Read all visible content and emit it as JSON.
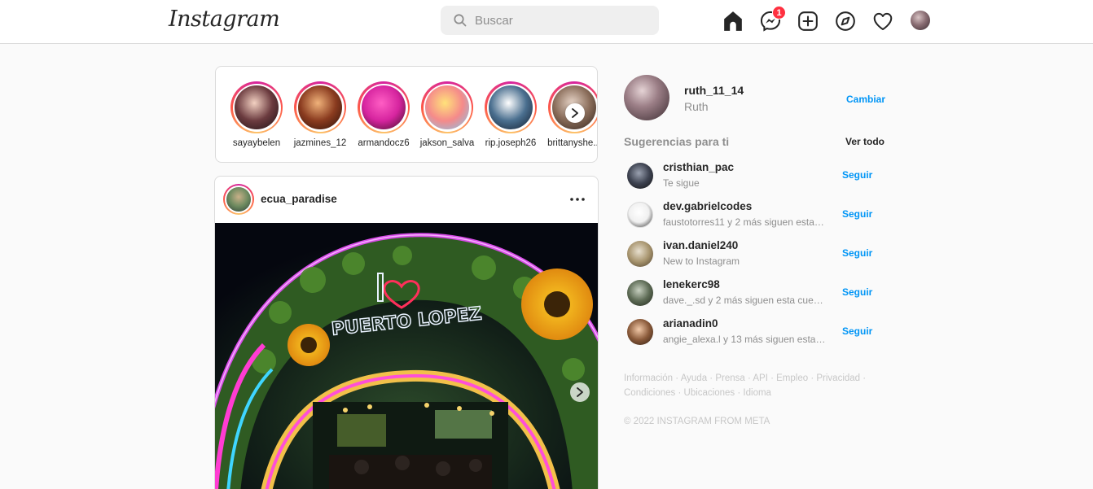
{
  "nav": {
    "logo": "Instagram",
    "search_placeholder": "Buscar",
    "messages_badge": "1",
    "icons": [
      "home-icon",
      "messenger-icon",
      "new-post-icon",
      "explore-icon",
      "activity-heart-icon",
      "profile-avatar"
    ]
  },
  "stories": [
    {
      "username": "sayaybelen",
      "colors": [
        "#f3d1c2",
        "#6b3b3f",
        "#1b1012"
      ]
    },
    {
      "username": "jazmines_12",
      "colors": [
        "#f0b27a",
        "#8a3b1f",
        "#2a0f08"
      ]
    },
    {
      "username": "armandocz6",
      "colors": [
        "#ff5ec4",
        "#d6249f",
        "#3a0d1f"
      ]
    },
    {
      "username": "jakson_salva",
      "colors": [
        "#ffe27a",
        "#f58a8a",
        "#7cc8f0"
      ]
    },
    {
      "username": "rip.joseph26",
      "colors": [
        "#ffffff",
        "#4a6f8f",
        "#101a2a"
      ]
    },
    {
      "username": "brittanyshe...",
      "colors": [
        "#e8d5c8",
        "#8a6d5a",
        "#2a1d16"
      ]
    }
  ],
  "post": {
    "username": "ecua_paradise",
    "image_text": "PUERTO LOPEZ"
  },
  "sidebar": {
    "username": "ruth_11_14",
    "full_name": "Ruth",
    "switch_label": "Cambiar",
    "suggestions_title": "Sugerencias para ti",
    "see_all": "Ver todo",
    "suggestions": [
      {
        "username": "cristhian_pac",
        "subtitle": "Te sigue",
        "follow": "Seguir",
        "avatar": [
          "#9aa1b0",
          "#3d4250",
          "#111"
        ]
      },
      {
        "username": "dev.gabrielcodes",
        "subtitle": "faustotorres11 y 2 más siguen esta cuenta",
        "follow": "Seguir",
        "avatar": [
          "#ffffff",
          "#f0f0f0",
          "#222"
        ]
      },
      {
        "username": "ivan.daniel240",
        "subtitle": "New to Instagram",
        "follow": "Seguir",
        "avatar": [
          "#e8e0cf",
          "#a8956f",
          "#4a3d2a"
        ]
      },
      {
        "username": "lenekerc98",
        "subtitle": "dave._.sd y 2 más siguen esta cuenta",
        "follow": "Seguir",
        "avatar": [
          "#c7d0c0",
          "#5d6b55",
          "#1d2318"
        ]
      },
      {
        "username": "arianadin0",
        "subtitle": "angie_alexa.l y 13 más siguen esta cuenta",
        "follow": "Seguir",
        "avatar": [
          "#f2c9a8",
          "#8a5a3a",
          "#2a1a10"
        ]
      }
    ],
    "footer_links": [
      "Información",
      "Ayuda",
      "Prensa",
      "API",
      "Empleo",
      "Privacidad",
      "Condiciones",
      "Ubicaciones",
      "Idioma"
    ],
    "copyright": "© 2022 INSTAGRAM FROM META"
  }
}
